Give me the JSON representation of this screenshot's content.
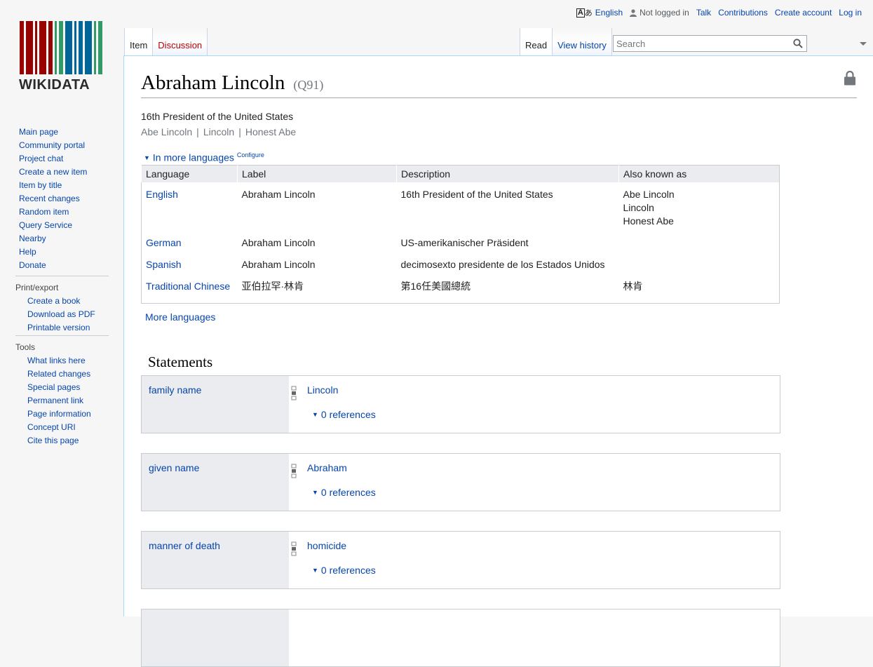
{
  "personal": {
    "language": "English",
    "not_logged_in": "Not logged in",
    "talk": "Talk",
    "contributions": "Contributions",
    "create_account": "Create account",
    "log_in": "Log in"
  },
  "logo": {
    "wordmark": "WIKIDATA"
  },
  "sidebar": {
    "navigation": [
      "Main page",
      "Community portal",
      "Project chat",
      "Create a new item",
      "Item by title",
      "Recent changes",
      "Random item",
      "Query Service",
      "Nearby",
      "Help",
      "Donate"
    ],
    "print_export": {
      "heading": "Print/export",
      "items": [
        "Create a book",
        "Download as PDF",
        "Printable version"
      ]
    },
    "tools": {
      "heading": "Tools",
      "items": [
        "What links here",
        "Related changes",
        "Special pages",
        "Permanent link",
        "Page information",
        "Concept URI",
        "Cite this page"
      ]
    }
  },
  "tabs": {
    "item": "Item",
    "discussion": "Discussion",
    "read": "Read",
    "view_history": "View history"
  },
  "search": {
    "placeholder": "Search"
  },
  "page": {
    "title": "Abraham Lincoln",
    "qid": "(Q91)",
    "description": "16th President of the United States",
    "aliases": [
      "Abe Lincoln",
      "Lincoln",
      "Honest Abe"
    ],
    "in_more_languages": "In more languages",
    "configure": "Configure",
    "more_languages": "More languages"
  },
  "lang_table": {
    "headers": [
      "Language",
      "Label",
      "Description",
      "Also known as"
    ],
    "rows": [
      {
        "language": "English",
        "label": "Abraham Lincoln",
        "description": "16th President of the United States",
        "aliases": [
          "Abe Lincoln",
          "Lincoln",
          "Honest Abe"
        ]
      },
      {
        "language": "German",
        "label": "Abraham Lincoln",
        "description": "US-amerikanischer Präsident",
        "aliases": []
      },
      {
        "language": "Spanish",
        "label": "Abraham Lincoln",
        "description": "decimosexto presidente de los Estados Unidos",
        "aliases": []
      },
      {
        "language": "Traditional Chinese",
        "label": "亚伯拉罕·林肯",
        "description": "第16任美國總統",
        "aliases": [
          "林肯"
        ]
      }
    ]
  },
  "statements": {
    "heading": "Statements",
    "items": [
      {
        "property": "family name",
        "value": "Lincoln",
        "references": "0 references"
      },
      {
        "property": "given name",
        "value": "Abraham",
        "references": "0 references"
      },
      {
        "property": "manner of death",
        "value": "homicide",
        "references": "0 references"
      }
    ]
  },
  "colors": {
    "link": "#0645ad",
    "redlink": "#ba0000",
    "muted": "#72777d"
  }
}
